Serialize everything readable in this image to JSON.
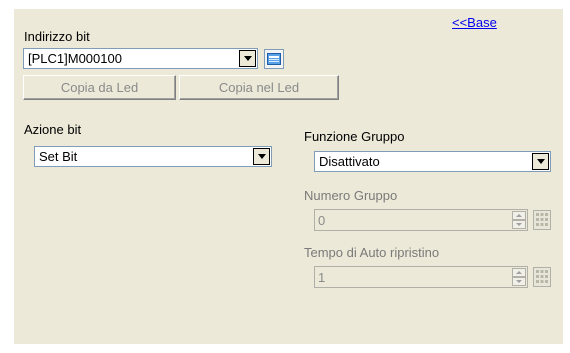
{
  "base_link": "<<Base",
  "bit_address": {
    "label": "Indirizzo bit",
    "value": "[PLC1]M000100",
    "icon": "keypad-icon"
  },
  "buttons": {
    "copy_from_led": "Copia da Led",
    "copy_to_led": "Copia nel Led"
  },
  "bit_action": {
    "label": "Azione bit",
    "value": "Set Bit"
  },
  "group_function": {
    "label": "Funzione Gruppo",
    "value": "Disattivato"
  },
  "group_number": {
    "label": "Numero Gruppo",
    "value": "0",
    "icon": "calculator-icon"
  },
  "auto_reset_time": {
    "label": "Tempo di Auto ripristino",
    "value": "1",
    "icon": "calculator-icon"
  }
}
